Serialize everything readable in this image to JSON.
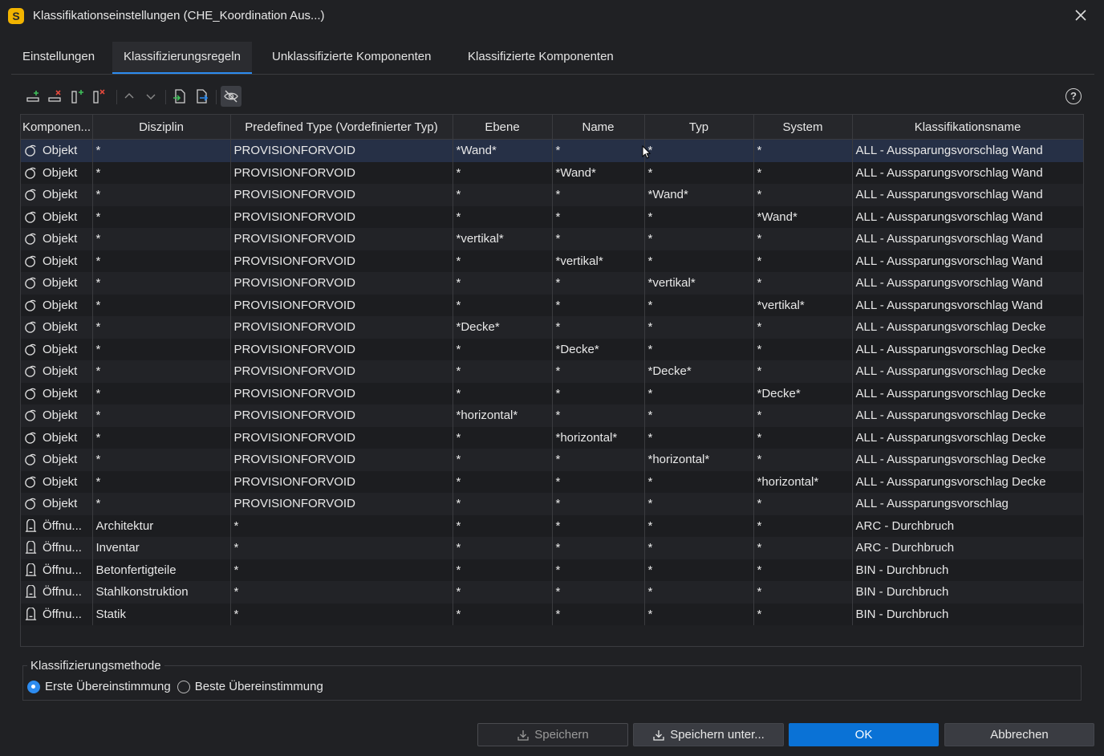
{
  "window": {
    "title": "Klassifikationseinstellungen (CHE_Koordination Aus...)",
    "app_icon_letter": "S"
  },
  "tabs": [
    {
      "label": "Einstellungen",
      "active": false
    },
    {
      "label": "Klassifizierungsregeln",
      "active": true
    },
    {
      "label": "Unklassifizierte Komponenten",
      "active": false
    },
    {
      "label": "Klassifizierte Komponenten",
      "active": false
    }
  ],
  "toolbar": {
    "buttons": [
      "add-row-icon",
      "remove-row-icon",
      "add-column-icon",
      "remove-column-icon",
      "move-up-icon",
      "move-down-icon",
      "import-icon",
      "export-icon",
      "hide-icon"
    ],
    "help_label": "?"
  },
  "table": {
    "columns": [
      "Komponen...",
      "Disziplin",
      "Predefined Type (Vordefinierter Typ)",
      "Ebene",
      "Name",
      "Typ",
      "System",
      "Klassifikationsname"
    ],
    "rows": [
      {
        "icon": "object-icon",
        "comp": "Objekt",
        "disziplin": "*",
        "predef": "PROVISIONFORVOID",
        "ebene": "*Wand*",
        "name": "*",
        "typ": "*",
        "system": "*",
        "klass": "ALL - Aussparungsvorschlag Wand",
        "selected": true
      },
      {
        "icon": "object-icon",
        "comp": "Objekt",
        "disziplin": "*",
        "predef": "PROVISIONFORVOID",
        "ebene": "*",
        "name": "*Wand*",
        "typ": "*",
        "system": "*",
        "klass": "ALL - Aussparungsvorschlag Wand"
      },
      {
        "icon": "object-icon",
        "comp": "Objekt",
        "disziplin": "*",
        "predef": "PROVISIONFORVOID",
        "ebene": "*",
        "name": "*",
        "typ": "*Wand*",
        "system": "*",
        "klass": "ALL - Aussparungsvorschlag Wand"
      },
      {
        "icon": "object-icon",
        "comp": "Objekt",
        "disziplin": "*",
        "predef": "PROVISIONFORVOID",
        "ebene": "*",
        "name": "*",
        "typ": "*",
        "system": "*Wand*",
        "klass": "ALL - Aussparungsvorschlag Wand"
      },
      {
        "icon": "object-icon",
        "comp": "Objekt",
        "disziplin": "*",
        "predef": "PROVISIONFORVOID",
        "ebene": "*vertikal*",
        "name": "*",
        "typ": "*",
        "system": "*",
        "klass": "ALL - Aussparungsvorschlag Wand"
      },
      {
        "icon": "object-icon",
        "comp": "Objekt",
        "disziplin": "*",
        "predef": "PROVISIONFORVOID",
        "ebene": "*",
        "name": "*vertikal*",
        "typ": "*",
        "system": "*",
        "klass": "ALL - Aussparungsvorschlag Wand"
      },
      {
        "icon": "object-icon",
        "comp": "Objekt",
        "disziplin": "*",
        "predef": "PROVISIONFORVOID",
        "ebene": "*",
        "name": "*",
        "typ": "*vertikal*",
        "system": "*",
        "klass": "ALL - Aussparungsvorschlag Wand"
      },
      {
        "icon": "object-icon",
        "comp": "Objekt",
        "disziplin": "*",
        "predef": "PROVISIONFORVOID",
        "ebene": "*",
        "name": "*",
        "typ": "*",
        "system": "*vertikal*",
        "klass": "ALL - Aussparungsvorschlag Wand"
      },
      {
        "icon": "object-icon",
        "comp": "Objekt",
        "disziplin": "*",
        "predef": "PROVISIONFORVOID",
        "ebene": "*Decke*",
        "name": "*",
        "typ": "*",
        "system": "*",
        "klass": "ALL - Aussparungsvorschlag Decke"
      },
      {
        "icon": "object-icon",
        "comp": "Objekt",
        "disziplin": "*",
        "predef": "PROVISIONFORVOID",
        "ebene": "*",
        "name": "*Decke*",
        "typ": "*",
        "system": "*",
        "klass": "ALL - Aussparungsvorschlag Decke"
      },
      {
        "icon": "object-icon",
        "comp": "Objekt",
        "disziplin": "*",
        "predef": "PROVISIONFORVOID",
        "ebene": "*",
        "name": "*",
        "typ": "*Decke*",
        "system": "*",
        "klass": "ALL - Aussparungsvorschlag Decke"
      },
      {
        "icon": "object-icon",
        "comp": "Objekt",
        "disziplin": "*",
        "predef": "PROVISIONFORVOID",
        "ebene": "*",
        "name": "*",
        "typ": "*",
        "system": "*Decke*",
        "klass": "ALL - Aussparungsvorschlag Decke"
      },
      {
        "icon": "object-icon",
        "comp": "Objekt",
        "disziplin": "*",
        "predef": "PROVISIONFORVOID",
        "ebene": "*horizontal*",
        "name": "*",
        "typ": "*",
        "system": "*",
        "klass": "ALL - Aussparungsvorschlag Decke"
      },
      {
        "icon": "object-icon",
        "comp": "Objekt",
        "disziplin": "*",
        "predef": "PROVISIONFORVOID",
        "ebene": "*",
        "name": "*horizontal*",
        "typ": "*",
        "system": "*",
        "klass": "ALL - Aussparungsvorschlag Decke"
      },
      {
        "icon": "object-icon",
        "comp": "Objekt",
        "disziplin": "*",
        "predef": "PROVISIONFORVOID",
        "ebene": "*",
        "name": "*",
        "typ": "*horizontal*",
        "system": "*",
        "klass": "ALL - Aussparungsvorschlag Decke"
      },
      {
        "icon": "object-icon",
        "comp": "Objekt",
        "disziplin": "*",
        "predef": "PROVISIONFORVOID",
        "ebene": "*",
        "name": "*",
        "typ": "*",
        "system": "*horizontal*",
        "klass": "ALL - Aussparungsvorschlag Decke"
      },
      {
        "icon": "object-icon",
        "comp": "Objekt",
        "disziplin": "*",
        "predef": "PROVISIONFORVOID",
        "ebene": "*",
        "name": "*",
        "typ": "*",
        "system": "*",
        "klass": "ALL - Aussparungsvorschlag"
      },
      {
        "icon": "opening-icon",
        "comp": "Öffnu...",
        "disziplin": "Architektur",
        "predef": "*",
        "ebene": "*",
        "name": "*",
        "typ": "*",
        "system": "*",
        "klass": "ARC - Durchbruch"
      },
      {
        "icon": "opening-icon",
        "comp": "Öffnu...",
        "disziplin": "Inventar",
        "predef": "*",
        "ebene": "*",
        "name": "*",
        "typ": "*",
        "system": "*",
        "klass": "ARC - Durchbruch"
      },
      {
        "icon": "opening-icon",
        "comp": "Öffnu...",
        "disziplin": "Betonfertigteile",
        "predef": "*",
        "ebene": "*",
        "name": "*",
        "typ": "*",
        "system": "*",
        "klass": "BIN - Durchbruch"
      },
      {
        "icon": "opening-icon",
        "comp": "Öffnu...",
        "disziplin": "Stahlkonstruktion",
        "predef": "*",
        "ebene": "*",
        "name": "*",
        "typ": "*",
        "system": "*",
        "klass": "BIN - Durchbruch"
      },
      {
        "icon": "opening-icon",
        "comp": "Öffnu...",
        "disziplin": "Statik",
        "predef": "*",
        "ebene": "*",
        "name": "*",
        "typ": "*",
        "system": "*",
        "klass": "BIN - Durchbruch"
      }
    ]
  },
  "method": {
    "legend": "Klassifizierungsmethode",
    "options": [
      {
        "label": "Erste Übereinstimmung",
        "checked": true
      },
      {
        "label": "Beste Übereinstimmung",
        "checked": false
      }
    ]
  },
  "buttons": {
    "save": "Speichern",
    "save_as": "Speichern unter...",
    "ok": "OK",
    "cancel": "Abbrechen"
  },
  "colors": {
    "accent": "#2d8cf0",
    "ok_button": "#0a72d6",
    "background": "#202124"
  }
}
